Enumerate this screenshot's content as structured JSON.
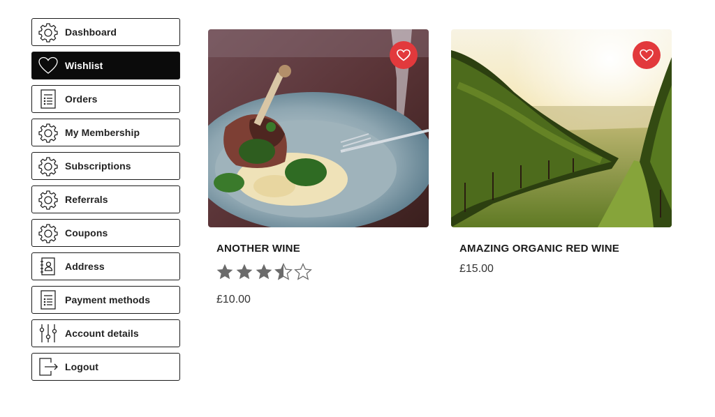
{
  "sidebar": {
    "items": [
      {
        "label": "Dashboard",
        "icon": "gear-icon",
        "active": false
      },
      {
        "label": "Wishlist",
        "icon": "heart-icon",
        "active": true
      },
      {
        "label": "Orders",
        "icon": "document-list-icon",
        "active": false
      },
      {
        "label": "My Membership",
        "icon": "gear-icon",
        "active": false
      },
      {
        "label": "Subscriptions",
        "icon": "gear-icon",
        "active": false
      },
      {
        "label": "Referrals",
        "icon": "gear-icon",
        "active": false
      },
      {
        "label": "Coupons",
        "icon": "gear-icon",
        "active": false
      },
      {
        "label": "Address",
        "icon": "address-book-icon",
        "active": false
      },
      {
        "label": "Payment methods",
        "icon": "document-list-icon",
        "active": false
      },
      {
        "label": "Account details",
        "icon": "sliders-icon",
        "active": false
      },
      {
        "label": "Logout",
        "icon": "logout-icon",
        "active": false
      }
    ]
  },
  "products": [
    {
      "title": "ANOTHER WINE",
      "price": "£10.00",
      "rating": 3.5,
      "rating_max": 5,
      "image": "plated-duck-dish-photo",
      "wishlisted": true
    },
    {
      "title": "AMAZING ORGANIC RED WINE",
      "price": "£15.00",
      "rating": null,
      "image": "vineyard-sunset-photo",
      "wishlisted": true
    }
  ],
  "colors": {
    "accent": "#e2393c",
    "active_nav_bg": "#0b0b0b",
    "star": "#6b6b6b"
  }
}
